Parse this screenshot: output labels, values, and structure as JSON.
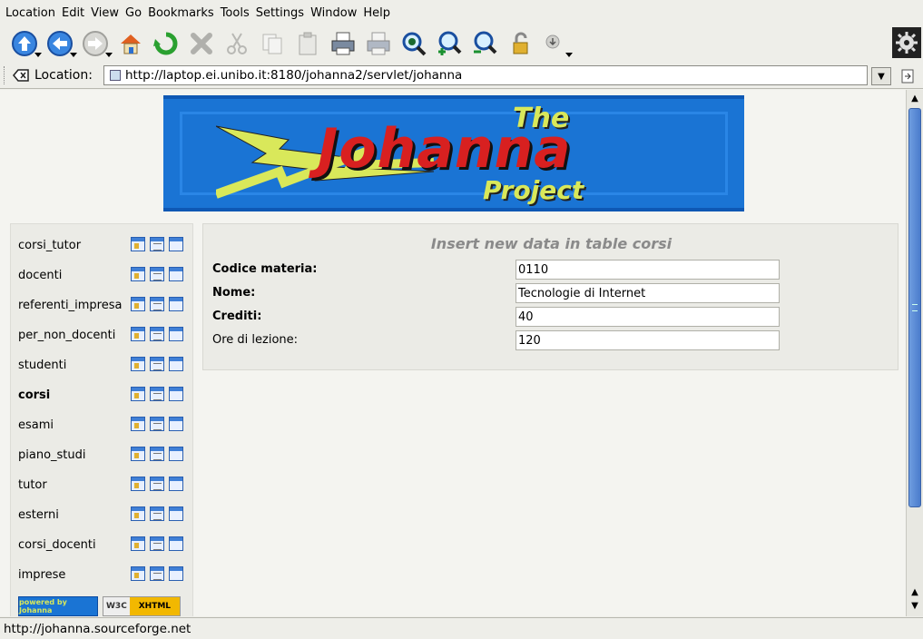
{
  "menu": [
    "Location",
    "Edit",
    "View",
    "Go",
    "Bookmarks",
    "Tools",
    "Settings",
    "Window",
    "Help"
  ],
  "toolbar": {
    "icons": [
      "up-icon",
      "back-icon",
      "forward-icon",
      "home-icon",
      "reload-icon",
      "stop-icon",
      "cut-icon",
      "copy-icon",
      "paste-icon",
      "print-icon",
      "print-frame-icon",
      "view-icon",
      "zoom-in-icon",
      "zoom-out-icon",
      "security-icon",
      "download-icon"
    ]
  },
  "location": {
    "label": "Location:",
    "url": "http://laptop.ei.unibo.it:8180/johanna2/servlet/johanna"
  },
  "banner": {
    "the": "The",
    "name": "Johanna",
    "project": "Project"
  },
  "sidebar": {
    "items": [
      {
        "label": "corsi_tutor",
        "active": false
      },
      {
        "label": "docenti",
        "active": false
      },
      {
        "label": "referenti_impresa",
        "active": false
      },
      {
        "label": "per_non_docenti",
        "active": false
      },
      {
        "label": "studenti",
        "active": false
      },
      {
        "label": "corsi",
        "active": true
      },
      {
        "label": "esami",
        "active": false
      },
      {
        "label": "piano_studi",
        "active": false
      },
      {
        "label": "tutor",
        "active": false
      },
      {
        "label": "esterni",
        "active": false
      },
      {
        "label": "corsi_docenti",
        "active": false
      },
      {
        "label": "imprese",
        "active": false
      }
    ],
    "badge_powered": "powered by Johanna",
    "badge_w3c": "W3C",
    "badge_xhtml": "XHTML"
  },
  "form": {
    "title": "Insert new data in table corsi",
    "fields": [
      {
        "label": "Codice materia:",
        "value": "0110",
        "required": true
      },
      {
        "label": "Nome:",
        "value": "Tecnologie di Internet",
        "required": true
      },
      {
        "label": "Crediti:",
        "value": "40",
        "required": true
      },
      {
        "label": "Ore di lezione:",
        "value": "120",
        "required": false
      }
    ]
  },
  "status": {
    "text": "http://johanna.sourceforge.net"
  },
  "colors": {
    "banner_bg": "#1a74d4",
    "banner_red": "#d82020",
    "banner_yellow": "#d9e85a",
    "scrollbar_thumb": "#5a8ad6"
  }
}
